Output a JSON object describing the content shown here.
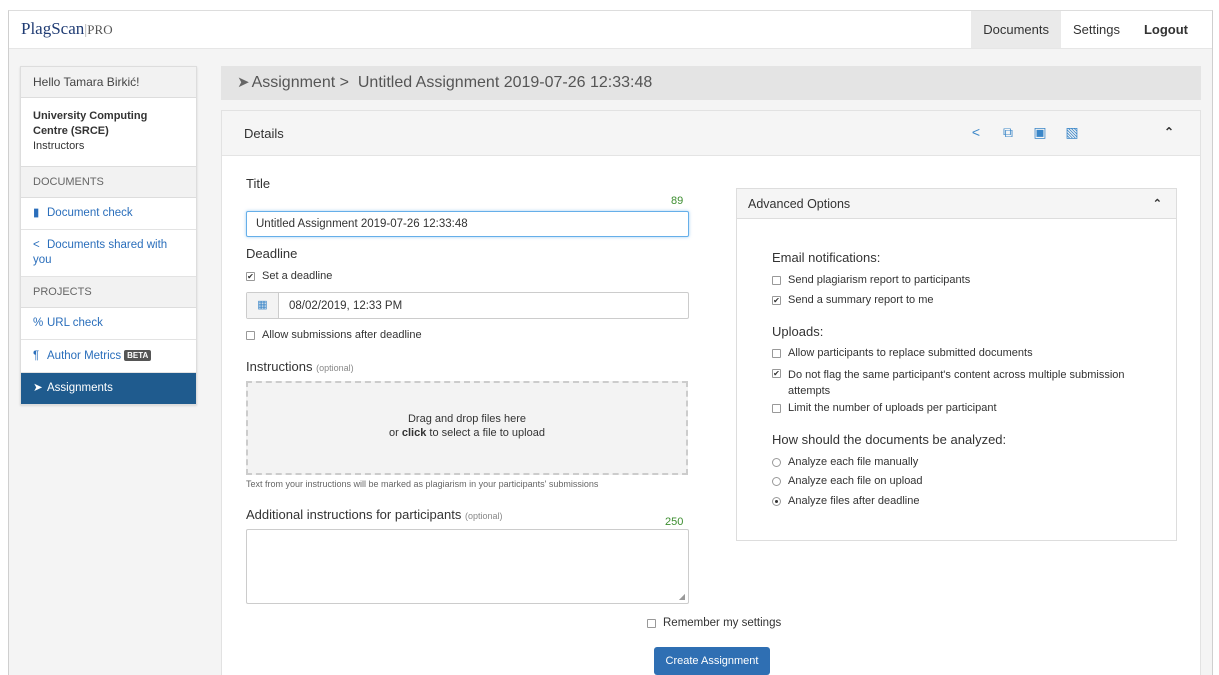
{
  "brand": {
    "logo": "PlagScan",
    "tier": "PRO"
  },
  "nav": {
    "documents": "Documents",
    "settings": "Settings",
    "logout": "Logout"
  },
  "sidebar": {
    "greeting": "Hello Tamara Birkić!",
    "org_name": "University Computing Centre (SRCE)",
    "role": "Instructors",
    "section_documents": "DOCUMENTS",
    "document_check": "Document check",
    "documents_shared": "Documents shared with you",
    "section_projects": "PROJECTS",
    "url_check": "URL check",
    "author_metrics": "Author Metrics",
    "beta": "BETA",
    "assignments": "Assignments"
  },
  "breadcrumb": {
    "root": "Assignment >",
    "title": "Untitled Assignment 2019-07-26 12:33:48"
  },
  "panel": {
    "title": "Details"
  },
  "form": {
    "title_label": "Title",
    "title_count": "89",
    "title_value": "Untitled Assignment 2019-07-26 12:33:48",
    "deadline_label": "Deadline",
    "set_deadline": "Set a deadline",
    "set_deadline_checked": true,
    "deadline_value": "08/02/2019, 12:33 PM",
    "allow_after": "Allow submissions after deadline",
    "instructions_label": "Instructions",
    "optional": "(optional)",
    "dropzone_line1": "Drag and drop files here",
    "dropzone_or": "or",
    "dropzone_click": "click",
    "dropzone_line2": "to select a file to upload",
    "instructions_hint": "Text from your instructions will be marked as plagiarism in your participants' submissions",
    "additional_label": "Additional instructions for participants",
    "additional_count": "250",
    "remember": "Remember my settings",
    "create_button": "Create Assignment"
  },
  "advanced": {
    "title": "Advanced Options",
    "email_heading": "Email notifications:",
    "send_report": "Send plagiarism report to participants",
    "send_summary": "Send a summary report to me",
    "uploads_heading": "Uploads:",
    "allow_replace": "Allow participants to replace submitted documents",
    "no_flag": "Do not flag the same participant's content across multiple submission attempts",
    "limit_uploads": "Limit the number of uploads per participant",
    "analyze_heading": "How should the documents be analyzed:",
    "analyze_manual": "Analyze each file manually",
    "analyze_upload": "Analyze each file on upload",
    "analyze_deadline": "Analyze files after deadline"
  },
  "colors": {
    "brand_blue": "#2f6fb3",
    "sidebar_active": "#1f5b8e",
    "link": "#2a6ebb",
    "counter_green": "#3c8d2f"
  },
  "icons": [
    "send-icon",
    "share-icon",
    "copy-icon",
    "archive-icon",
    "trash-icon",
    "chevron-up-icon",
    "file-icon",
    "link-icon",
    "paragraph-icon",
    "calendar-icon"
  ]
}
